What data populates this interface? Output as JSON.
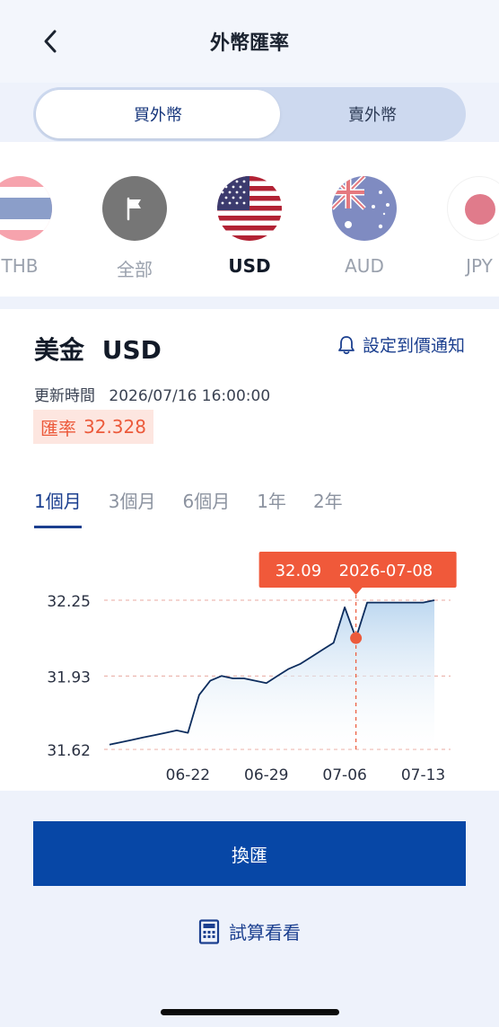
{
  "header": {
    "title": "外幣匯率"
  },
  "segment": {
    "buy": "買外幣",
    "sell": "賣外幣"
  },
  "currencies": [
    {
      "code": "THB",
      "icon": "thailand-flag-icon"
    },
    {
      "code": "全部",
      "icon": "flag-icon"
    },
    {
      "code": "USD",
      "icon": "usa-flag-icon",
      "selected": true
    },
    {
      "code": "AUD",
      "icon": "australia-flag-icon"
    },
    {
      "code": "JPY",
      "icon": "japan-flag-icon"
    }
  ],
  "detail": {
    "name": "美金",
    "code": "USD",
    "alert": "設定到價通知",
    "update_label": "更新時間",
    "update_time": "2026/07/16 16:00:00",
    "rate_label": "匯率",
    "rate": "32.328"
  },
  "periods": [
    "1個月",
    "3個月",
    "6個月",
    "1年",
    "2年"
  ],
  "chart_data": {
    "type": "area",
    "x": [
      "2026-06-15",
      "2026-06-16",
      "2026-06-17",
      "2026-06-18",
      "2026-06-19",
      "2026-06-20",
      "2026-06-21",
      "2026-06-22",
      "2026-06-23",
      "2026-06-24",
      "2026-06-25",
      "2026-06-26",
      "2026-06-27",
      "2026-06-28",
      "2026-06-29",
      "2026-06-30",
      "2026-07-01",
      "2026-07-02",
      "2026-07-03",
      "2026-07-04",
      "2026-07-05",
      "2026-07-06",
      "2026-07-07",
      "2026-07-08",
      "2026-07-09",
      "2026-07-10",
      "2026-07-11",
      "2026-07-12",
      "2026-07-13",
      "2026-07-14"
    ],
    "values": [
      31.64,
      31.65,
      31.66,
      31.67,
      31.68,
      31.69,
      31.7,
      31.69,
      31.85,
      31.91,
      31.93,
      31.92,
      31.92,
      31.91,
      31.9,
      31.93,
      31.96,
      31.98,
      32.01,
      32.04,
      32.07,
      32.22,
      32.09,
      32.24,
      32.24,
      32.24,
      32.24,
      32.24,
      32.24,
      32.25
    ],
    "yticks": [
      "31.62",
      "31.93",
      "32.25"
    ],
    "ylim": [
      31.62,
      32.25
    ],
    "xticks": [
      "06-22",
      "06-29",
      "07-06",
      "07-13"
    ],
    "tooltip": {
      "value": "32.09",
      "date": "2026-07-08"
    },
    "colors": {
      "line": "#0d2d5e",
      "fill": "#b9d5ef",
      "marker": "#ec5a3b",
      "tooltip": "#f0593a",
      "grid": "#e8aaa0"
    }
  },
  "actions": {
    "exchange": "換匯",
    "calc": "試算看看"
  },
  "colors": {
    "primary": "#0747a6",
    "accent": "#ec5a3b"
  }
}
